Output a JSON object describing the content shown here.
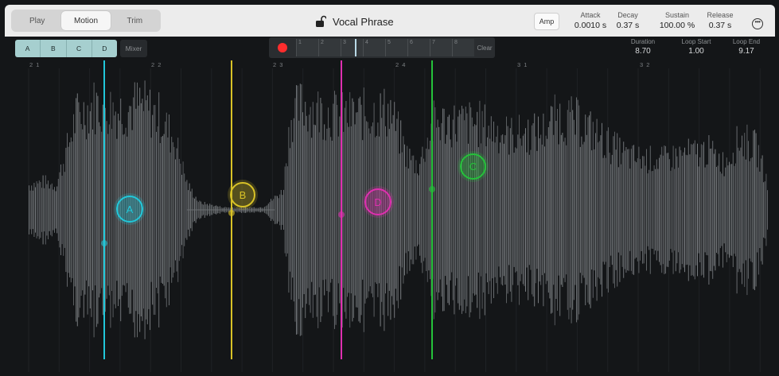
{
  "modes": [
    "Play",
    "Motion",
    "Trim"
  ],
  "active_mode": "Motion",
  "title": "Vocal Phrase",
  "amp_label": "Amp",
  "params": [
    {
      "label": "Attack",
      "value": "0.0010 s"
    },
    {
      "label": "Decay",
      "value": "0.37 s"
    },
    {
      "label": "Sustain",
      "value": "100.00 %"
    },
    {
      "label": "Release",
      "value": "0.37 s"
    }
  ],
  "markers": [
    "A",
    "B",
    "C",
    "D"
  ],
  "mixer_label": "Mixer",
  "recorder": {
    "step_numbers": [
      "1",
      "2",
      "3",
      "4",
      "5",
      "6",
      "7",
      "8"
    ],
    "clear_label": "Clear"
  },
  "info": [
    {
      "label": "Duration",
      "value": "8.70"
    },
    {
      "label": "Loop Start",
      "value": "1.00"
    },
    {
      "label": "Loop End",
      "value": "9.17"
    }
  ],
  "ruler": [
    "2 1",
    "2 2",
    "2 3",
    "2 4",
    "3 1",
    "3 2"
  ],
  "handles": [
    {
      "label": "A",
      "color": "#21c7d9"
    },
    {
      "label": "B",
      "color": "#d8c227"
    },
    {
      "label": "C",
      "color": "#25c23a"
    },
    {
      "label": "D",
      "color": "#e02fb0"
    }
  ],
  "colors": {
    "marker_buttons": "#a6cfcf",
    "record": "#ff2d2d",
    "waveform": "#8c9094"
  }
}
